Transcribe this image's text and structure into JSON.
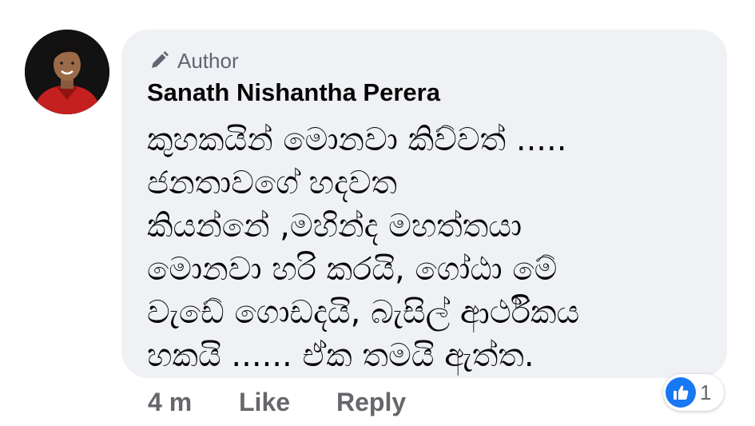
{
  "comment": {
    "badge_label": "Author",
    "author_name": "Sanath Nishantha Perera",
    "body_lines": [
      "කුහකයින් මොනවා කිව්වත් .....",
      "ජනතාවගේ හදවත",
      "කියන්නේ ,මහින්ද මහත්තයා",
      "මොනවා හරි කරයි, ගෝඨා මේ",
      "වැඩේ ගොඩදයි, බැසිල් ආර්ථිකය",
      "හකයි ...... ඒක තමයි ඇත්ත."
    ]
  },
  "actions": {
    "time": "4 m",
    "like": "Like",
    "reply": "Reply"
  },
  "reactions": {
    "icon": "like-thumb-icon",
    "count": "1"
  },
  "colors": {
    "bubble_bg": "#eff1f4",
    "meta_text": "#65676b",
    "like_blue": "#1877f2"
  }
}
